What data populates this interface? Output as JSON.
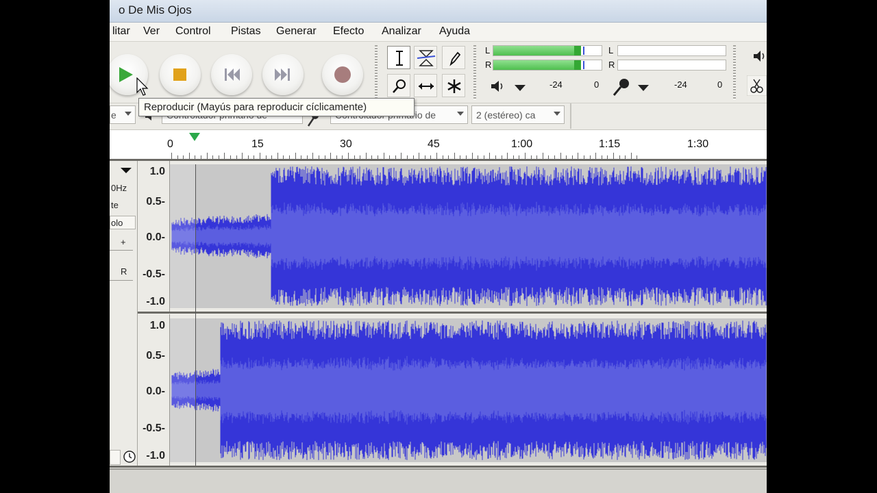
{
  "window": {
    "title": "o De Mis Ojos"
  },
  "menu": [
    "litar",
    "Ver",
    "Control",
    "Pistas",
    "Generar",
    "Efecto",
    "Analizar",
    "Ayuda"
  ],
  "transport": {
    "buttons": [
      {
        "name": "play-button",
        "icon": "play-icon",
        "color": "#3aa83a"
      },
      {
        "name": "stop-button",
        "icon": "stop-icon",
        "color": "#e1a21b"
      },
      {
        "name": "skip-start-button",
        "icon": "skip-start-icon",
        "color": "#9a9aa8"
      },
      {
        "name": "skip-end-button",
        "icon": "skip-end-icon",
        "color": "#9a9aa8"
      },
      {
        "name": "record-button",
        "icon": "record-icon",
        "color": "#a77d7d"
      }
    ]
  },
  "tools": [
    "selection-tool",
    "envelope-tool",
    "draw-tool",
    "zoom-tool",
    "timeshift-tool",
    "multi-tool"
  ],
  "meters": {
    "playback": {
      "left_label": "L",
      "right_label": "R",
      "scale": [
        "-24",
        "0"
      ]
    },
    "record": {
      "left_label": "L",
      "right_label": "R",
      "scale": [
        "-24",
        "0"
      ]
    }
  },
  "device": {
    "host_partial": "e",
    "output_device": "Controlador primario de",
    "input_device": "Controlador primario de",
    "channels": "2 (estéreo) ca"
  },
  "tooltip": "Reproducir (Mayús para reproducir cíclicamente)",
  "timeline": {
    "labels": [
      "0",
      "15",
      "30",
      "45",
      "1:00",
      "1:15",
      "1:30"
    ]
  },
  "track": {
    "rate_partial": "0Hz",
    "format_partial": "te",
    "mute_partial": "olo",
    "gain_symbol": "+",
    "pan_symbol": "R"
  },
  "vertical_ruler": [
    "1.0",
    "0.5-",
    "0.0-",
    "-0.5-",
    "-1.0"
  ],
  "colors": {
    "wave_dark": "#3535d8",
    "wave_light": "#5b5ee0",
    "wave_bg": "#c8c8c8",
    "accent_play": "#3aa83a"
  }
}
